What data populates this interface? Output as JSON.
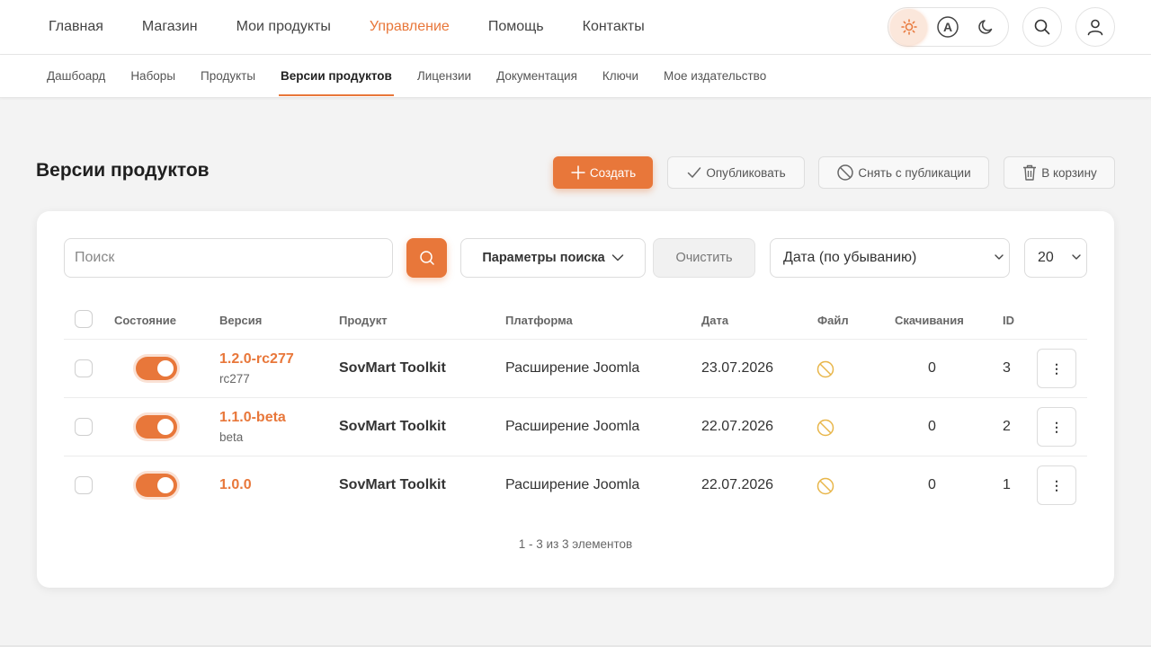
{
  "nav": {
    "items": [
      {
        "label": "Главная",
        "active": false
      },
      {
        "label": "Магазин",
        "active": false
      },
      {
        "label": "Мои продукты",
        "active": false
      },
      {
        "label": "Управление",
        "active": true
      },
      {
        "label": "Помощь",
        "active": false
      },
      {
        "label": "Контакты",
        "active": false
      }
    ],
    "theme": {
      "selected": "light",
      "auto_letter": "A"
    }
  },
  "subnav": {
    "items": [
      {
        "label": "Дашбоард"
      },
      {
        "label": "Наборы"
      },
      {
        "label": "Продукты"
      },
      {
        "label": "Версии продуктов",
        "active": true
      },
      {
        "label": "Лицензии"
      },
      {
        "label": "Документация"
      },
      {
        "label": "Ключи"
      },
      {
        "label": "Мое издательство"
      }
    ]
  },
  "page": {
    "title": "Версии продуктов"
  },
  "toolbar": {
    "create": "Создать",
    "publish": "Опубликовать",
    "unpublish": "Снять с публикации",
    "trash": "В корзину"
  },
  "filters": {
    "search_placeholder": "Поиск",
    "search_value": "",
    "params": "Параметры поиска",
    "clear": "Очистить",
    "sort": "Дата (по убыванию)",
    "limit": "20"
  },
  "table": {
    "headers": {
      "state": "Состояние",
      "version": "Версия",
      "product": "Продукт",
      "platform": "Платформа",
      "date": "Дата",
      "file": "Файл",
      "downloads": "Скачивания",
      "id": "ID"
    },
    "rows": [
      {
        "version": "1.2.0-rc277",
        "stability": "rc277",
        "product": "SovMart Toolkit",
        "platform": "Расширение Joomla",
        "date": "23.07.2026",
        "downloads": "0",
        "id": "3",
        "more": "⋮",
        "published": true
      },
      {
        "version": "1.1.0-beta",
        "stability": "beta",
        "product": "SovMart Toolkit",
        "platform": "Расширение Joomla",
        "date": "22.07.2026",
        "downloads": "0",
        "id": "2",
        "more": "⋮",
        "published": true
      },
      {
        "version": "1.0.0",
        "stability": "",
        "product": "SovMart Toolkit",
        "platform": "Расширение Joomla",
        "date": "22.07.2026",
        "downloads": "0",
        "id": "1",
        "more": "⋮",
        "published": true
      }
    ],
    "footer": "1 - 3 из 3 элементов"
  },
  "colors": {
    "accent": "#e8773a",
    "file_missing": "#e8b64a"
  },
  "icons": [
    "sun-icon",
    "auto-theme-icon",
    "moon-icon",
    "search-icon",
    "user-icon",
    "plus-icon",
    "check-icon",
    "ban-icon",
    "trash-icon",
    "chevron-down-icon",
    "no-file-icon",
    "more-icon"
  ]
}
